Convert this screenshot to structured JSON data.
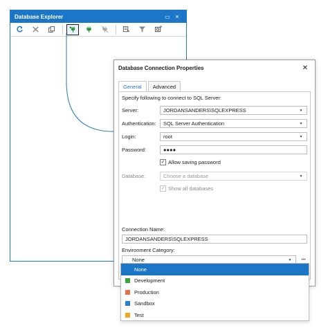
{
  "explorer": {
    "title": "Database Explorer",
    "tools": [
      {
        "name": "refresh-icon",
        "active": false
      },
      {
        "name": "delete-icon",
        "active": false
      },
      {
        "name": "copy-icon",
        "active": false
      },
      {
        "name": "new-connection-icon",
        "active": true
      },
      {
        "name": "connect-icon",
        "active": false
      },
      {
        "name": "disconnect-icon",
        "active": false
      },
      {
        "name": "edit-connection-icon",
        "active": false
      },
      {
        "name": "filter-icon",
        "active": false
      },
      {
        "name": "properties-icon",
        "active": false
      }
    ]
  },
  "dialog": {
    "title": "Database Connection Properties",
    "tabs": [
      "General",
      "Advanced"
    ],
    "intro": "Specify following to connect to SQL Server:",
    "server_label": "Server:",
    "server_value": "JORDANSANDERS\\SQLEXPRESS",
    "auth_label": "Authentication:",
    "auth_value": "SQL Server Authentication",
    "login_label": "Login:",
    "login_value": "root",
    "password_label": "Password:",
    "password_value": "●●●●",
    "allow_saving_label": "Allow saving password",
    "database_label": "Database:",
    "database_placeholder": "Choose a database",
    "show_all_label": "Show all databases",
    "conn_name_label": "Connection Name:",
    "conn_name_value": "JORDANSANDERS\\SQLEXPRESS",
    "env_label": "Environment Category:",
    "env_value": "None"
  },
  "dropdown": {
    "items": [
      {
        "label": "None",
        "color": null
      },
      {
        "label": "Development",
        "color": "#3aa63a"
      },
      {
        "label": "Production",
        "color": "#e8704a"
      },
      {
        "label": "Sandbox",
        "color": "#2a7fd4"
      },
      {
        "label": "Test",
        "color": "#f5a623"
      }
    ]
  },
  "colors": {
    "accent": "#1c76c8"
  }
}
